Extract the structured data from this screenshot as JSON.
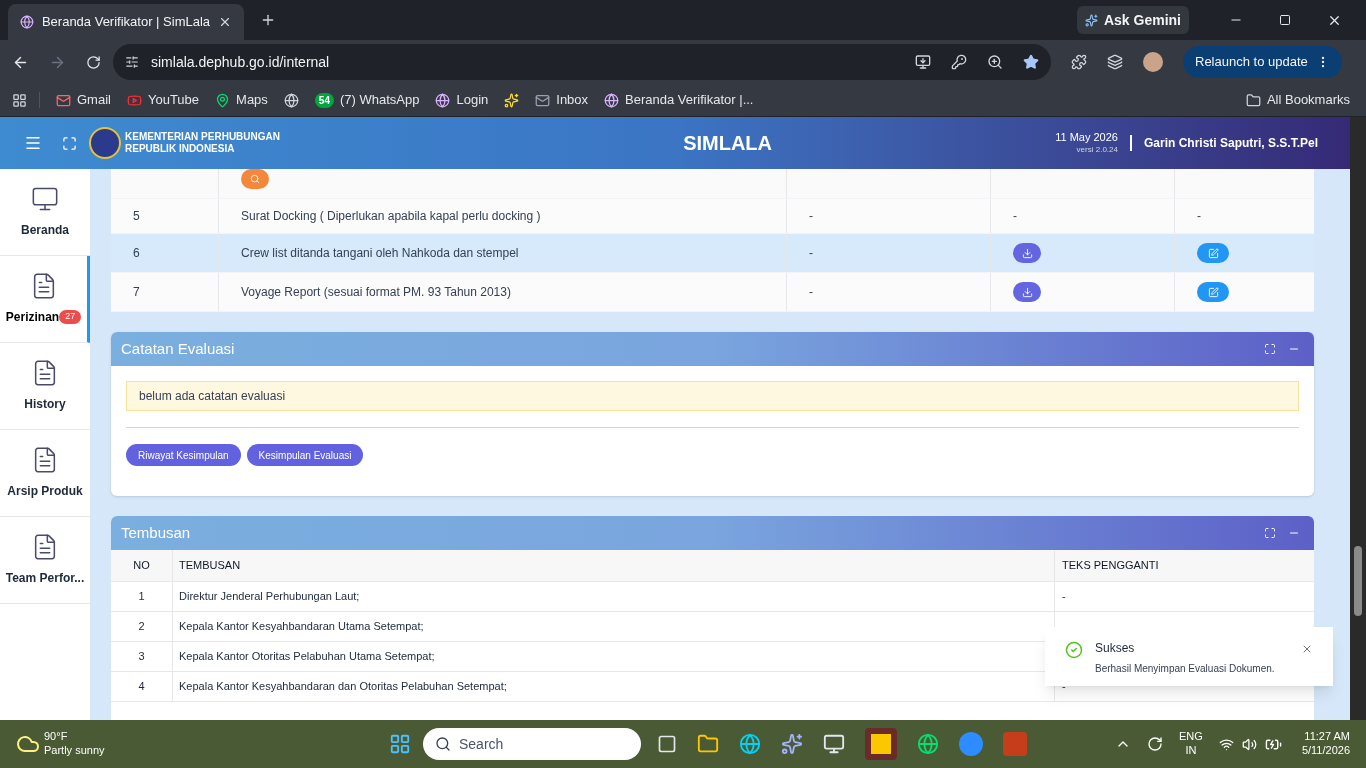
{
  "browser": {
    "tab_title": "Beranda Verifikator | SimLala",
    "url": "simlala.dephub.go.id/internal",
    "ask_label": "Ask Gemini",
    "relaunch_label": "Relaunch to update",
    "bookmarks": [
      {
        "kind": "gmail",
        "label": "Gmail"
      },
      {
        "kind": "youtube",
        "label": "YouTube"
      },
      {
        "kind": "maps",
        "label": "Maps"
      },
      {
        "kind": "globe"
      },
      {
        "kind": "whatsapp",
        "label": "(7) WhatsApp",
        "badge": "54"
      },
      {
        "kind": "emblem",
        "label": "Login"
      },
      {
        "kind": "pinwheel"
      },
      {
        "kind": "mail",
        "label": "Inbox"
      },
      {
        "kind": "emblem",
        "label": "Beranda Verifikator |..."
      }
    ],
    "all_bookmarks": "All Bookmarks"
  },
  "header": {
    "org_line1": "KEMENTERIAN PERHUBUNGAN",
    "org_line2": "REPUBLIK INDONESIA",
    "title": "SIMLALA",
    "date": "11 May 2026",
    "version": "versi 2.0.24",
    "user": "Garin Christi Saputri, S.S.T.Pel"
  },
  "sidebar": [
    {
      "label": "Beranda",
      "selected": false
    },
    {
      "label": "Perizinan",
      "selected": true,
      "badge": "27"
    },
    {
      "label": "History",
      "selected": false
    },
    {
      "label": "Arsip Produk",
      "selected": false
    },
    {
      "label": "Team Perfor...",
      "selected": false
    }
  ],
  "documents": {
    "rows": [
      {
        "kind": "action_only",
        "cells": [
          {
            "kind": "search"
          }
        ]
      },
      {
        "kind": "item",
        "no": "5",
        "name": "Surat Docking ( Diperlukan apabila kapal perlu docking )",
        "highlighted": false,
        "cells": [
          {
            "kind": "text",
            "text": "-"
          },
          {
            "kind": "text",
            "text": "-"
          },
          {
            "kind": "text",
            "text": "-"
          }
        ]
      },
      {
        "kind": "item",
        "no": "6",
        "name": "Crew list ditanda tangani oleh Nahkoda dan stempel",
        "highlighted": true,
        "cells": [
          {
            "kind": "text",
            "text": "-"
          },
          {
            "kind": "download"
          },
          {
            "kind": "edit"
          }
        ]
      },
      {
        "kind": "item",
        "no": "7",
        "name": "Voyage Report (sesuai format PM. 93 Tahun 2013)",
        "highlighted": false,
        "cells": [
          {
            "kind": "text",
            "text": "-"
          },
          {
            "kind": "download"
          },
          {
            "kind": "edit"
          }
        ]
      }
    ]
  },
  "catatan": {
    "title": "Catatan Evaluasi",
    "note": "belum ada catatan evaluasi",
    "buttons": [
      "Riwayat Kesimpulan",
      "Kesimpulan Evaluasi"
    ]
  },
  "tembusan": {
    "title": "Tembusan",
    "columns": [
      "NO",
      "TEMBUSAN",
      "TEKS PENGGANTI"
    ],
    "rows": [
      [
        "1",
        "Direktur Jenderal Perhubungan Laut;",
        "-"
      ],
      [
        "2",
        "Kepala Kantor Kesyahbandaran Utama Setempat;",
        ""
      ],
      [
        "3",
        "Kepala Kantor Otoritas Pelabuhan Utama Setempat;",
        ""
      ],
      [
        "4",
        "Kepala Kantor Kesyahbandaran dan Otoritas Pelabuhan Setempat;",
        "-"
      ]
    ]
  },
  "toast": {
    "title": "Sukses",
    "message": "Berhasil Menyimpan Evaluasi Dokumen."
  },
  "taskbar": {
    "temperature": "90°F",
    "condition": "Partly sunny",
    "search_placeholder": "Search",
    "lang1": "ENG",
    "lang2": "IN",
    "time": "11:27 AM",
    "date": "5/11/2026"
  }
}
